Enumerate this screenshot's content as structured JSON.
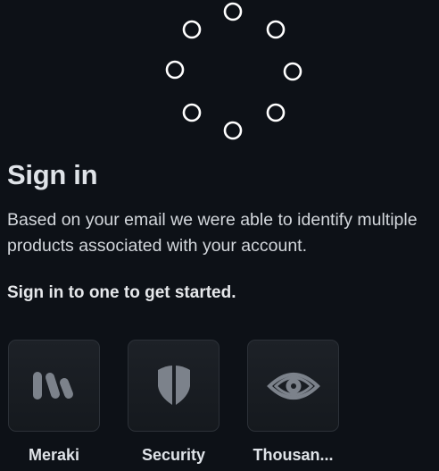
{
  "heading": {
    "title": "Sign in",
    "description": "Based on your email we were able to identify multiple products associated with your account.",
    "call_to_action": "Sign in to one to get started."
  },
  "loader": {
    "icon": "loading-spinner-icon"
  },
  "products": [
    {
      "label": "Meraki",
      "icon": "meraki-logo-icon"
    },
    {
      "label": "Security",
      "icon": "shield-icon"
    },
    {
      "label": "Thousan...",
      "icon": "eye-icon"
    }
  ],
  "colors": {
    "background": "#0d1117",
    "tile": "#1b1f25",
    "tile_border": "#2c3138",
    "icon_gray": "#7c828b",
    "text": "#e6e8eb"
  }
}
